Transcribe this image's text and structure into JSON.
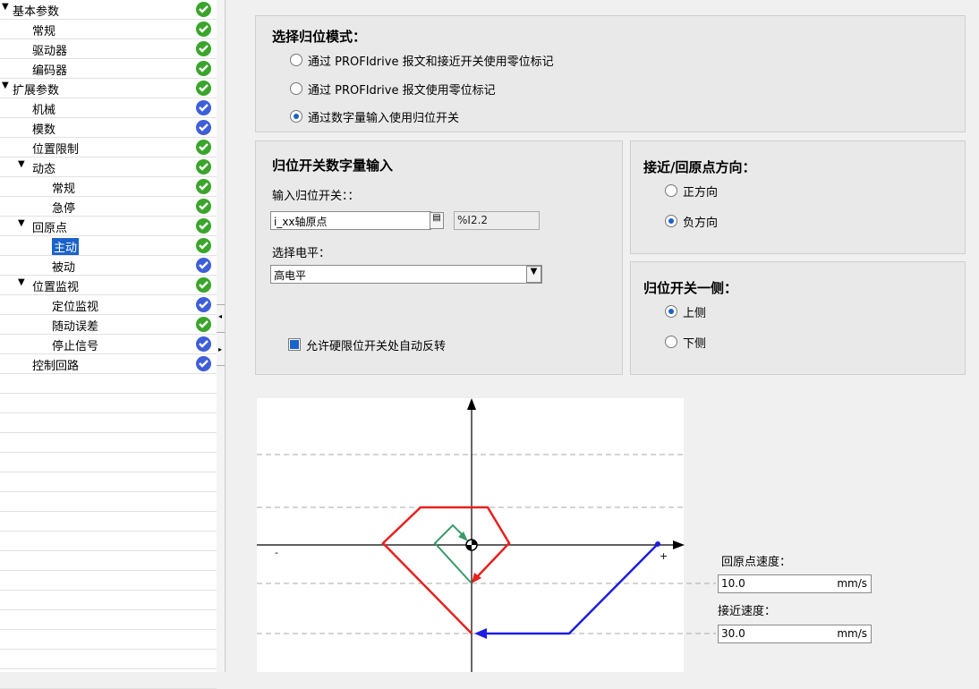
{
  "tree": {
    "items": [
      {
        "label": "基本参数",
        "indent": 0,
        "arrow": "▼",
        "status": "green"
      },
      {
        "label": "常规",
        "indent": 1,
        "arrow": "",
        "status": "green"
      },
      {
        "label": "驱动器",
        "indent": 1,
        "arrow": "",
        "status": "green"
      },
      {
        "label": "编码器",
        "indent": 1,
        "arrow": "",
        "status": "green"
      },
      {
        "label": "扩展参数",
        "indent": 0,
        "arrow": "▼",
        "status": "green"
      },
      {
        "label": "机械",
        "indent": 1,
        "arrow": "",
        "status": "blue"
      },
      {
        "label": "模数",
        "indent": 1,
        "arrow": "",
        "status": "blue"
      },
      {
        "label": "位置限制",
        "indent": 1,
        "arrow": "",
        "status": "green"
      },
      {
        "label": "动态",
        "indent": 1,
        "arrow": "▼",
        "status": "green"
      },
      {
        "label": "常规",
        "indent": 2,
        "arrow": "",
        "status": "green"
      },
      {
        "label": "急停",
        "indent": 2,
        "arrow": "",
        "status": "green"
      },
      {
        "label": "回原点",
        "indent": 1,
        "arrow": "▼",
        "status": "green"
      },
      {
        "label": "主动",
        "indent": 2,
        "arrow": "",
        "status": "green",
        "selected": true
      },
      {
        "label": "被动",
        "indent": 2,
        "arrow": "",
        "status": "blue"
      },
      {
        "label": "位置监视",
        "indent": 1,
        "arrow": "▼",
        "status": "green"
      },
      {
        "label": "定位监视",
        "indent": 2,
        "arrow": "",
        "status": "blue"
      },
      {
        "label": "随动误差",
        "indent": 2,
        "arrow": "",
        "status": "green"
      },
      {
        "label": "停止信号",
        "indent": 2,
        "arrow": "",
        "status": "blue"
      },
      {
        "label": "控制回路",
        "indent": 1,
        "arrow": "",
        "status": "blue"
      }
    ]
  },
  "mode": {
    "title": "选择归位模式：",
    "options": [
      {
        "label": "通过 PROFIdrive 报文和接近开关使用零位标记",
        "checked": false
      },
      {
        "label": "通过 PROFIdrive 报文使用零位标记",
        "checked": false
      },
      {
        "label": "通过数字量输入使用归位开关",
        "checked": true
      }
    ]
  },
  "switch_input": {
    "title": "归位开关数字量输入",
    "input_label": "输入归位开关：：",
    "input_value": "i_xx轴原点",
    "address": "%I2.2",
    "level_label": "选择电平：",
    "level_value": "高电平",
    "auto_reverse_label": "允许硬限位开关处自动反转",
    "auto_reverse_checked": true
  },
  "direction": {
    "title": "接近/回原点方向：",
    "options": [
      {
        "label": "正方向",
        "checked": false
      },
      {
        "label": "负方向",
        "checked": true
      }
    ]
  },
  "side": {
    "title": "归位开关一侧：",
    "options": [
      {
        "label": "上侧",
        "checked": true
      },
      {
        "label": "下侧",
        "checked": false
      }
    ]
  },
  "diagram": {
    "minus": "-",
    "plus": "+",
    "homing_speed_label": "回原点速度：",
    "homing_speed_value": "10.0",
    "approach_speed_label": "接近速度：",
    "approach_speed_value": "30.0",
    "unit": "mm/s",
    "colors": {
      "red": "#e8201e",
      "green": "#3a9a6a",
      "blue": "#1e1ee0"
    }
  }
}
